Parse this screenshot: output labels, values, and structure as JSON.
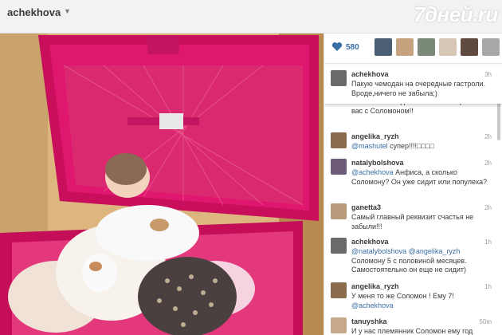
{
  "header": {
    "username": "achekhova",
    "watermark": "7дней.ru"
  },
  "post": {
    "likes": "580",
    "caption": {
      "author": "achekhova",
      "time": "3h",
      "text": "Пакую чемодан на очередные гастроли. Вроде,ничего не забыла;)"
    },
    "partial_comment": {
      "line1": "счастьем чемодан!!! Это точно про",
      "line2": "вас с Соломоном!!"
    },
    "comments": [
      {
        "author": "angelika_ryzh",
        "time": "2h",
        "mention": "@mashutel",
        "text": " супер!!!!□□□□"
      },
      {
        "author": "natalybolshova",
        "time": "2h",
        "mention": "@achekhova",
        "text": " Анфиса, а сколько Соломону? Он уже сидит или популеха?"
      },
      {
        "author": "ganetta3",
        "time": "2h",
        "mention": "",
        "text": "Самый главный реквизит счастья не забыли!!!"
      },
      {
        "author": "achekhova",
        "time": "1h",
        "mention": "@natalybolshova @angelika_ryzh",
        "text": " Соломону 5 с половиной месяцев. Самостоятельно он еще не сидит)"
      },
      {
        "author": "angelika_ryzh",
        "time": "1h",
        "mention": "",
        "text": "У меня то же Соломон ! Ему 7!",
        "mention_after": "@achekhova"
      },
      {
        "author": "tanuyshka",
        "time": "50m",
        "mention": "",
        "text": "И у нас племянник Соломон ему год"
      }
    ]
  },
  "icons": {
    "heart": "heart-icon",
    "chevron": "chevron-down-icon"
  },
  "colors": {
    "link": "#3a6ea5",
    "suitcase": "#e0176f"
  }
}
